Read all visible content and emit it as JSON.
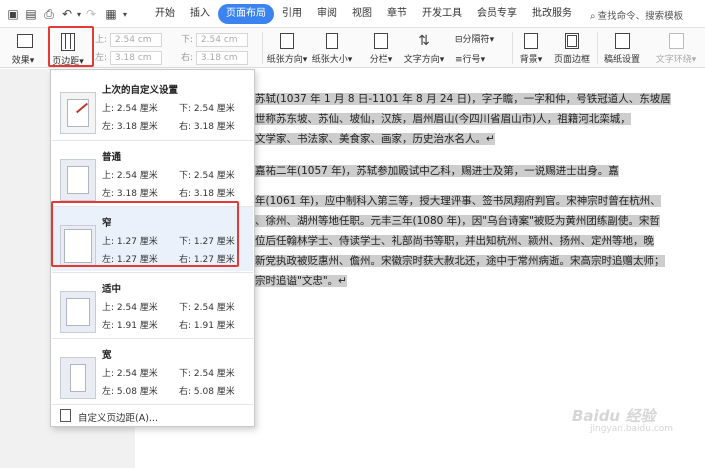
{
  "menubar": {
    "tabs": [
      "开始",
      "插入",
      "页面布局",
      "引用",
      "审阅",
      "视图",
      "章节",
      "开发工具",
      "会员专享",
      "批改服务"
    ],
    "active_tab": "页面布局",
    "search_placeholder": "查找命令、搜索模板"
  },
  "ribbon": {
    "effects_label": "效果",
    "margins_label": "页边距",
    "top_label": "上:",
    "top_value": "2.54 cm",
    "bottom_label": "下:",
    "bottom_value": "2.54 cm",
    "left_label": "左:",
    "left_value": "3.18 cm",
    "right_label": "右:",
    "right_value": "3.18 cm",
    "orientation_label": "纸张方向",
    "size_label": "纸张大小",
    "columns_label": "分栏",
    "text_direction_label": "文字方向",
    "section_break_label": "分隔符",
    "line_numbers_label": "行号",
    "background_label": "背景",
    "page_border_label": "页面边框",
    "draft_setting_label": "稿纸设置",
    "text_wrap_label": "文字环绕"
  },
  "dropdown": {
    "presets": [
      {
        "title": "上次的自定义设置",
        "top": "上: 2.54 厘米",
        "bottom": "下: 2.54 厘米",
        "left": "左: 3.18 厘米",
        "right": "右: 3.18 厘米"
      },
      {
        "title": "普通",
        "top": "上: 2.54 厘米",
        "bottom": "下: 2.54 厘米",
        "left": "左: 3.18 厘米",
        "right": "右: 3.18 厘米"
      },
      {
        "title": "窄",
        "top": "上: 1.27 厘米",
        "bottom": "下: 1.27 厘米",
        "left": "左: 1.27 厘米",
        "right": "右: 1.27 厘米"
      },
      {
        "title": "适中",
        "top": "上: 2.54 厘米",
        "bottom": "下: 2.54 厘米",
        "left": "左: 1.91 厘米",
        "right": "右: 1.91 厘米"
      },
      {
        "title": "宽",
        "top": "上: 2.54 厘米",
        "bottom": "下: 2.54 厘米",
        "left": "左: 5.08 厘米",
        "right": "右: 5.08 厘米"
      }
    ],
    "custom_label": "自定义页边距(A)..."
  },
  "document": {
    "lines": [
      "苏轼(1037 年 1 月 8 日-1101 年 8 月 24 日)，字子瞻，一字和仲，号铁冠道人、东坡居",
      "世称苏东坡、苏仙、坡仙，汉族，眉州眉山(今四川省眉山市)人，祖籍河北栾城，",
      "文学家、书法家、美食家、画家，历史治水名人。↵",
      "嘉祐二年(1057 年)，苏轼参加殿试中乙科，赐进士及第，一说赐进士出身。嘉",
      "年(1061 年)，应中制科入第三等，授大理评事、签书凤翔府判官。宋神宗时曾在杭州、",
      "、徐州、湖州等地任职。元丰三年(1080 年)，因\"乌台诗案\"被贬为黄州团练副使。宋哲",
      "位后任翰林学士、侍读学士、礼部尚书等职，并出知杭州、颍州、扬州、定州等地，晚",
      "新党执政被贬惠州、儋州。宋徽宗时获大赦北还，途中于常州病逝。宋高宗时追赠太师；",
      "宗时追谥\"文忠\"。↵"
    ]
  },
  "watermark": {
    "brand": "Baidu 经验",
    "url": "jingyan.baidu.com"
  }
}
